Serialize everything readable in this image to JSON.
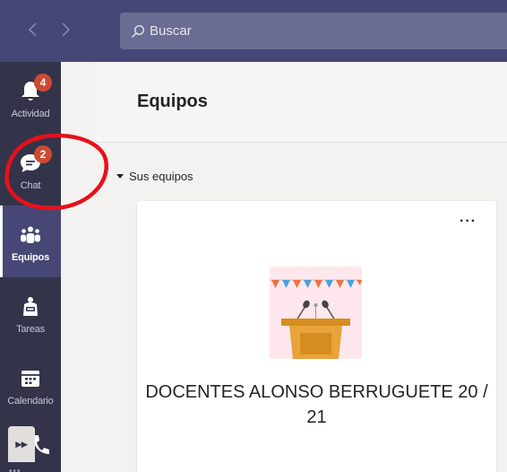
{
  "search": {
    "placeholder": "Buscar"
  },
  "rail": {
    "items": [
      {
        "label": "Actividad",
        "icon": "bell-icon",
        "badge": "4"
      },
      {
        "label": "Chat",
        "icon": "chat-icon",
        "badge": "2"
      },
      {
        "label": "Equipos",
        "icon": "teams-icon"
      },
      {
        "label": "Tareas",
        "icon": "assignments-icon"
      },
      {
        "label": "Calendario",
        "icon": "calendar-icon"
      }
    ],
    "active": "Equipos"
  },
  "main": {
    "title": "Equipos",
    "section_title": "Sus equipos",
    "team": {
      "name": "DOCENTES ALONSO BERRUGUETE 20 / 21",
      "more": "···"
    }
  },
  "colors": {
    "topbar": "#464775",
    "rail": "#33344a",
    "badge": "#cc4a31",
    "annotation": "#e8101a"
  }
}
